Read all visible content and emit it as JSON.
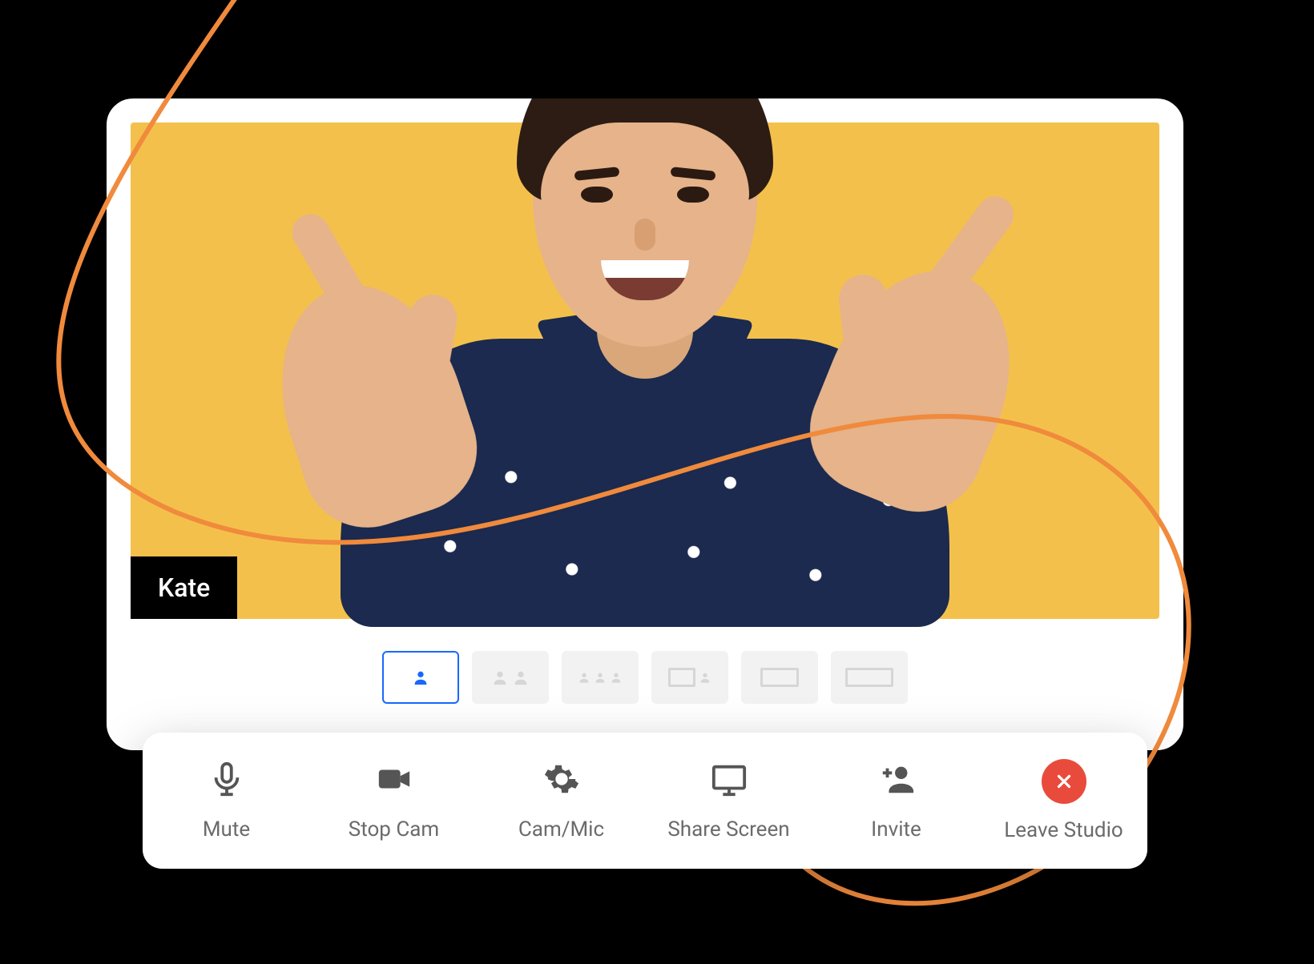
{
  "colors": {
    "video_bg": "#f3c14b",
    "accent": "#1768ff",
    "leave": "#e84b3c",
    "swirl": "#f08a3c"
  },
  "participant": {
    "name": "Kate"
  },
  "layouts": {
    "active_index": 0,
    "options": [
      {
        "id": "solo",
        "icon": "single-person"
      },
      {
        "id": "two",
        "icon": "two-people"
      },
      {
        "id": "three",
        "icon": "three-people"
      },
      {
        "id": "pip-1",
        "icon": "screen-plus-person"
      },
      {
        "id": "pip-2",
        "icon": "screen-plus-small"
      },
      {
        "id": "screen",
        "icon": "screen-only"
      }
    ]
  },
  "toolbar": {
    "mute": {
      "label": "Mute",
      "icon": "microphone-icon"
    },
    "stop_cam": {
      "label": "Stop Cam",
      "icon": "video-camera-icon"
    },
    "cam_mic": {
      "label": "Cam/Mic",
      "icon": "gear-icon"
    },
    "share": {
      "label": "Share Screen",
      "icon": "monitor-icon"
    },
    "invite": {
      "label": "Invite",
      "icon": "add-person-icon"
    },
    "leave": {
      "label": "Leave Studio",
      "icon": "close-icon"
    }
  }
}
